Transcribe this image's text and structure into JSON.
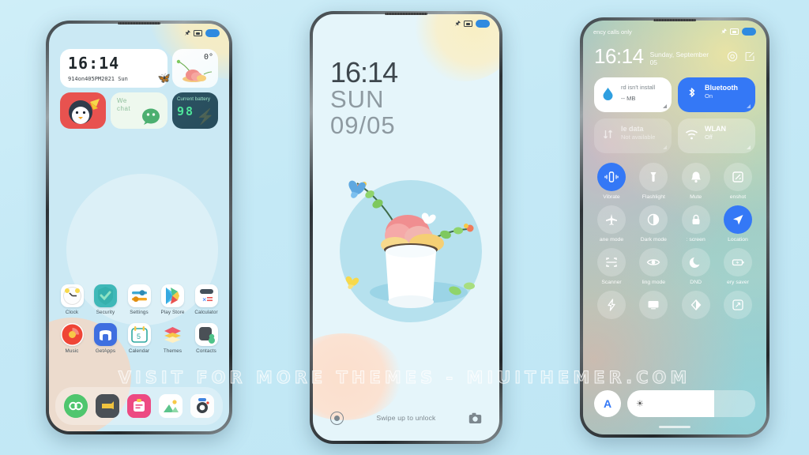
{
  "watermark": "VISIT FOR MORE THEMES - MIUITHEMER.COM",
  "colors": {
    "page_bg": "#c9ecf7",
    "accent_blue": "#3478f6",
    "home_bg": "#cbe9f4",
    "lock_bg": "#e5f5fa",
    "battery_green": "#4ee59a",
    "penguin_red": "#e8524f"
  },
  "phone1": {
    "name": "home-screen",
    "statusbar": {
      "icons": [
        "bluetooth-icon",
        "sdcard-icon",
        "battery-icon"
      ]
    },
    "clock_widget": {
      "time": "16:14",
      "date": "914on405PM2021  Sun",
      "decor": "butterfly-icon"
    },
    "weather_widget": {
      "temperature": "0°",
      "art": "flower-plate-illustration"
    },
    "penguin_widget": {
      "art": "penguin-icon"
    },
    "wechat_widget": {
      "label_line1": "We",
      "label_line2": "chat"
    },
    "battery_widget": {
      "caption": "Current battery",
      "value": "98",
      "icon": "lightning-bolt-icon"
    },
    "apps_row1": [
      {
        "name": "Clock",
        "icon": "clock-icon"
      },
      {
        "name": "Security",
        "icon": "shield-icon"
      },
      {
        "name": "Settings",
        "icon": "sliders-icon"
      },
      {
        "name": "Play Store",
        "icon": "play-store-icon"
      },
      {
        "name": "Calculator",
        "icon": "calculator-icon"
      }
    ],
    "apps_row2": [
      {
        "name": "Music",
        "icon": "music-icon"
      },
      {
        "name": "GetApps",
        "icon": "getapps-icon"
      },
      {
        "name": "Calendar",
        "icon": "calendar-icon",
        "day": "5"
      },
      {
        "name": "Themes",
        "icon": "themes-icon"
      },
      {
        "name": "Contacts",
        "icon": "contacts-icon"
      }
    ],
    "dock": [
      {
        "name": "Phone",
        "icon": "phone-icon"
      },
      {
        "name": "Messages",
        "icon": "messages-icon"
      },
      {
        "name": "Notes",
        "icon": "notes-icon"
      },
      {
        "name": "Gallery",
        "icon": "gallery-icon"
      },
      {
        "name": "Camera",
        "icon": "camera-icon"
      }
    ]
  },
  "phone2": {
    "name": "lock-screen",
    "statusbar": {
      "icons": [
        "bluetooth-icon",
        "sdcard-icon",
        "battery-icon"
      ]
    },
    "time": "16:14",
    "weekday": "SUN",
    "date": "09/05",
    "hint": "Swipe up to unlock",
    "left_shortcut": "flashlight-icon",
    "right_shortcut": "camera-icon",
    "art": "vase-flowers-butterflies-illustration"
  },
  "phone3": {
    "name": "control-center",
    "statusbar": {
      "carrier": "ency calls only",
      "icons": [
        "bluetooth-icon",
        "sdcard-icon",
        "battery-icon"
      ]
    },
    "header": {
      "time": "16:14",
      "date": "Sunday, September 05",
      "settings_icon": "gear-icon",
      "edit_icon": "edit-icon"
    },
    "tiles": [
      {
        "title": "rd isn't install",
        "subtitle": "-- MB",
        "icon": "sdcard-drop-icon",
        "state": "white"
      },
      {
        "title": "Bluetooth",
        "subtitle": "On",
        "icon": "bluetooth-icon",
        "state": "on"
      },
      {
        "title": "le data",
        "subtitle": "Not available",
        "icon": "mobile-data-icon",
        "state": "disabled"
      },
      {
        "title": "WLAN",
        "subtitle": "Off",
        "icon": "wifi-icon",
        "state": "off"
      }
    ],
    "toggles_row1": [
      {
        "label": "Vibrate",
        "icon": "vibrate-icon",
        "active": true
      },
      {
        "label": "Flashlight",
        "icon": "flashlight-icon",
        "active": false
      },
      {
        "label": "Mute",
        "icon": "bell-icon",
        "active": false
      },
      {
        "label": "enshot",
        "icon": "screenshot-icon",
        "active": false
      }
    ],
    "toggles_row2": [
      {
        "label": "ane mode",
        "icon": "airplane-icon",
        "active": false
      },
      {
        "label": "Dark mode",
        "icon": "contrast-icon",
        "active": false
      },
      {
        "label": ": screen",
        "icon": "lock-icon",
        "active": false
      },
      {
        "label": "Location",
        "icon": "location-icon",
        "active": true
      }
    ],
    "toggles_row3": [
      {
        "label": "Scanner",
        "icon": "scanner-icon",
        "active": false
      },
      {
        "label": "ling mode",
        "icon": "eye-icon",
        "active": false
      },
      {
        "label": "DND",
        "icon": "moon-icon",
        "active": false
      },
      {
        "label": "ery saver",
        "icon": "battery-save-icon",
        "active": false
      }
    ],
    "toggles_row4": [
      {
        "label": "",
        "icon": "quick-ball-icon",
        "active": false
      },
      {
        "label": "",
        "icon": "cast-icon",
        "active": false
      },
      {
        "label": "",
        "icon": "half-contrast-icon",
        "active": false
      },
      {
        "label": "",
        "icon": "expand-icon",
        "active": false
      }
    ],
    "brightness": {
      "auto_label": "A",
      "icon": "sun-icon",
      "percent": 68
    }
  }
}
